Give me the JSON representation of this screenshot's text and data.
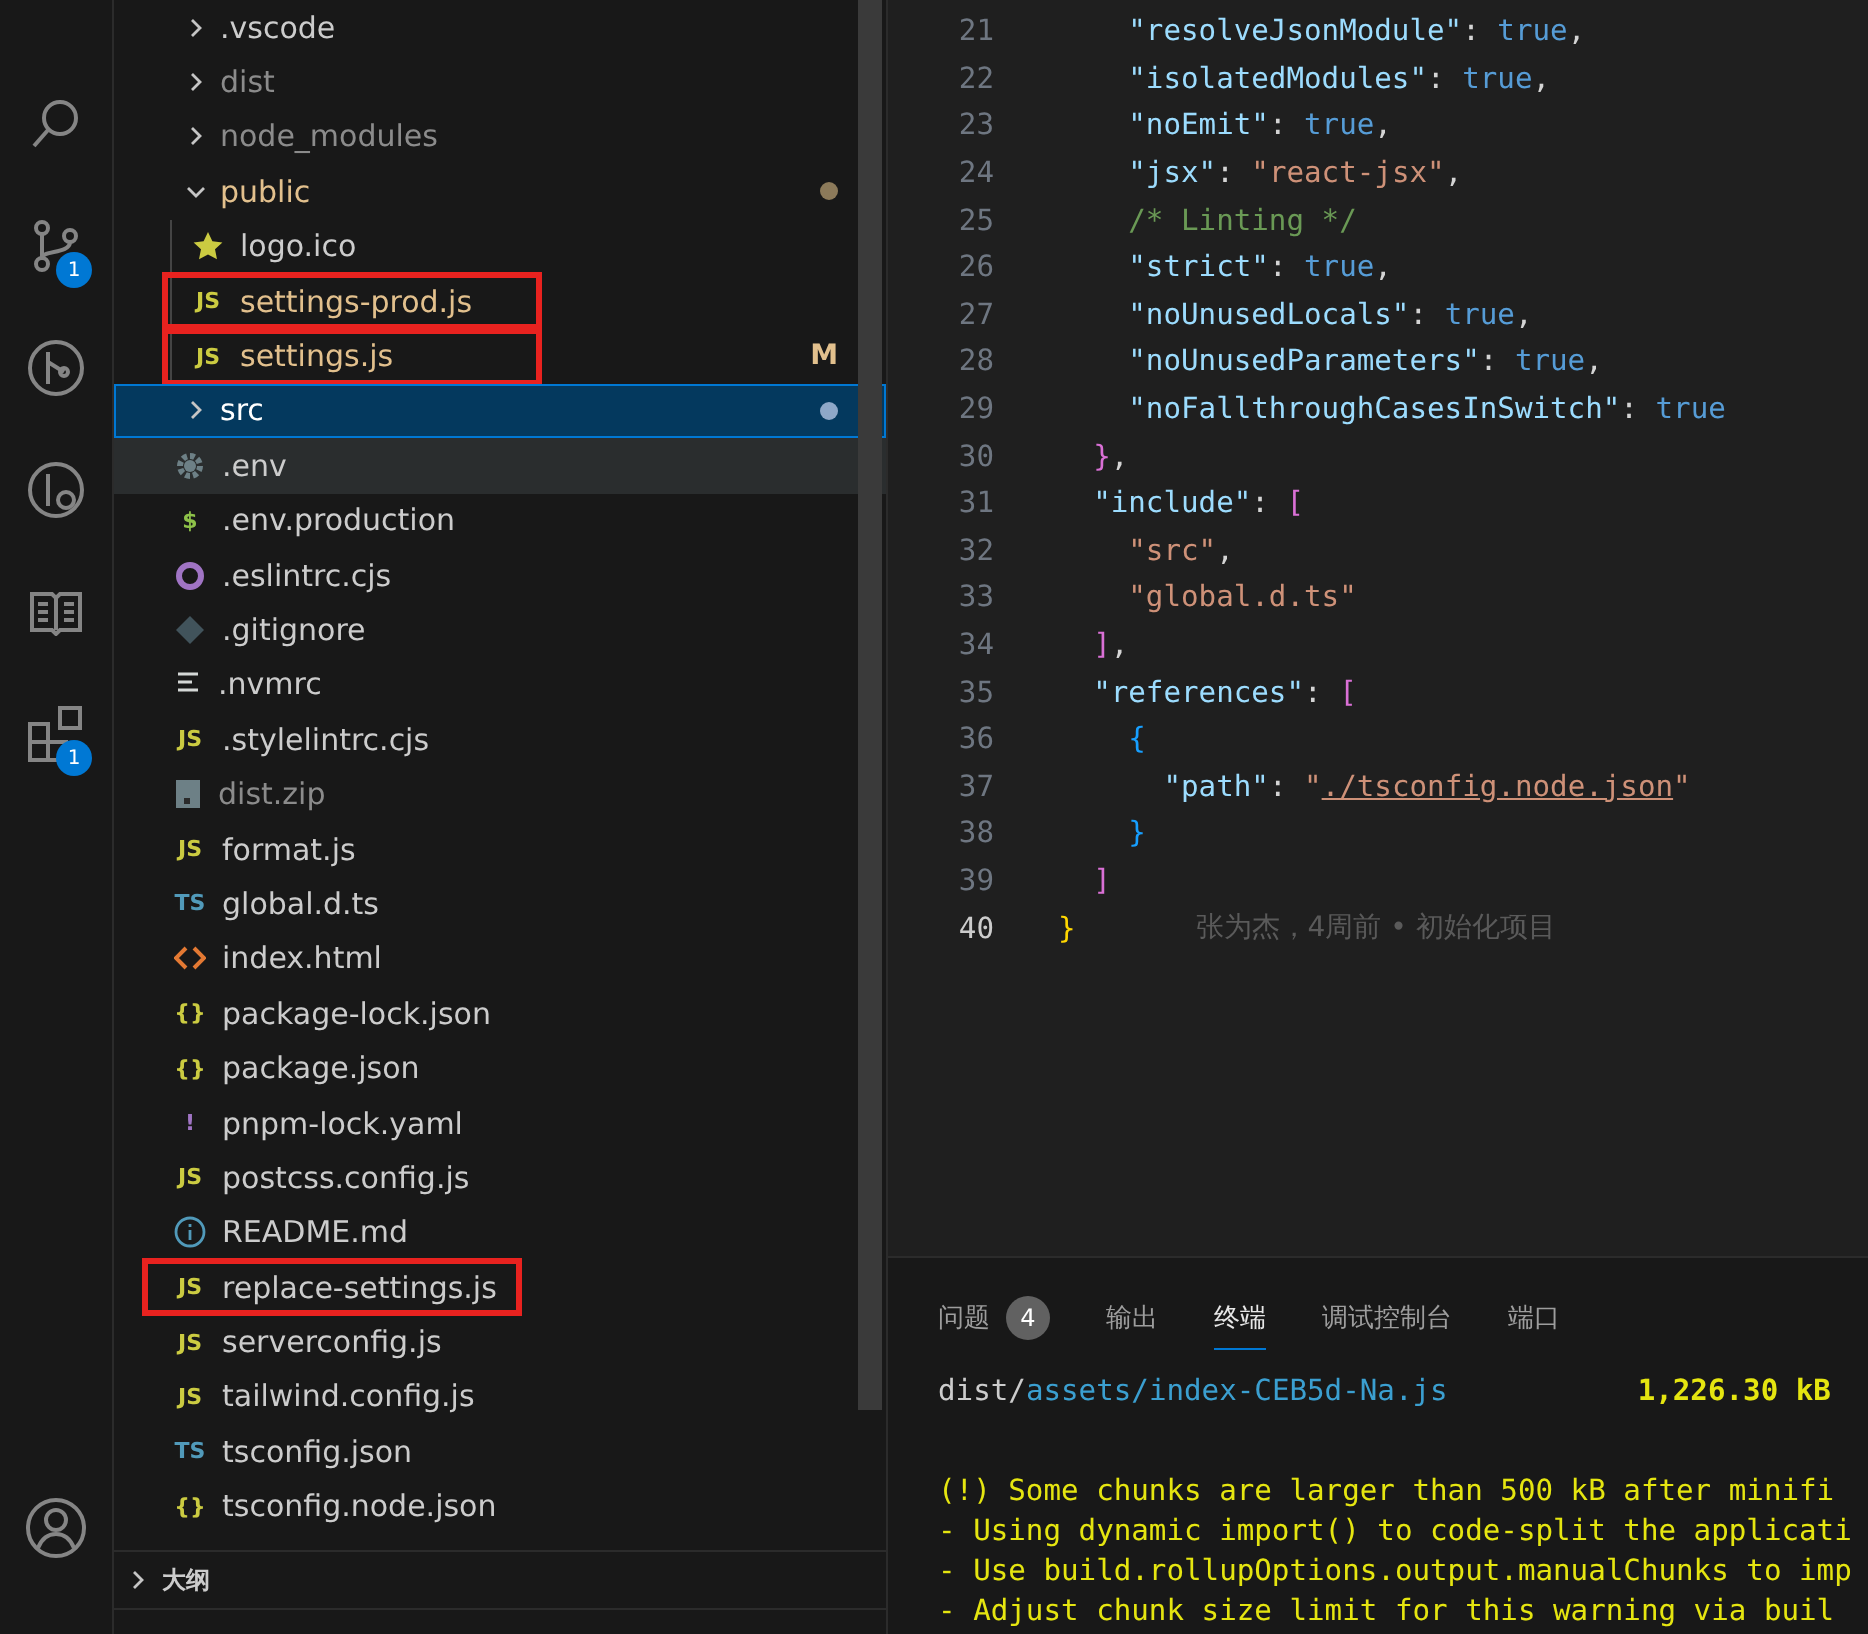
{
  "activity_bar": {
    "items": [
      {
        "kind": "search"
      },
      {
        "kind": "source-control",
        "badge": "1"
      },
      {
        "kind": "git-graph"
      },
      {
        "kind": "debug"
      },
      {
        "kind": "book"
      },
      {
        "kind": "extensions",
        "badge": "1"
      }
    ],
    "bottom": [
      {
        "kind": "account"
      }
    ]
  },
  "explorer": {
    "items": [
      {
        "name": ".vscode",
        "kind": "folder",
        "expanded": false,
        "dimmed": false,
        "modified": false,
        "selected": false,
        "hovered": false,
        "boxed": false,
        "pending": false
      },
      {
        "name": "dist",
        "kind": "folder",
        "expanded": false,
        "dimmed": true,
        "modified": false,
        "selected": false,
        "hovered": false,
        "boxed": false,
        "pending": false
      },
      {
        "name": "node_modules",
        "kind": "folder",
        "expanded": false,
        "dimmed": true,
        "modified": false,
        "selected": false,
        "hovered": false,
        "boxed": false,
        "pending": false
      },
      {
        "name": "public",
        "kind": "folder",
        "expanded": true,
        "dimmed": false,
        "modified": true,
        "selected": false,
        "hovered": false,
        "boxed": false,
        "pending": true,
        "children": [
          {
            "name": "logo.ico",
            "kind": "star",
            "dimmed": false,
            "modified": false,
            "selected": false,
            "hovered": false,
            "boxed": false
          },
          {
            "name": "settings-prod.js",
            "kind": "js",
            "glyph": "JS",
            "dimmed": false,
            "modified": true,
            "selected": false,
            "hovered": false,
            "boxed": true
          },
          {
            "name": "settings.js",
            "kind": "js",
            "glyph": "JS",
            "dimmed": false,
            "modified": true,
            "selected": false,
            "hovered": false,
            "boxed": true,
            "status": "M"
          }
        ]
      },
      {
        "name": "src",
        "kind": "folder",
        "expanded": false,
        "dimmed": false,
        "modified": false,
        "selected": true,
        "hovered": false,
        "boxed": false,
        "pending": true
      },
      {
        "name": ".env",
        "kind": "gear",
        "dimmed": false,
        "modified": false,
        "selected": false,
        "hovered": true,
        "boxed": false
      },
      {
        "name": ".env.production",
        "kind": "dollar",
        "glyph": "$",
        "dimmed": false,
        "modified": false,
        "selected": false,
        "hovered": false,
        "boxed": false
      },
      {
        "name": ".eslintrc.cjs",
        "kind": "ring",
        "dimmed": false,
        "modified": false,
        "selected": false,
        "hovered": false,
        "boxed": false
      },
      {
        "name": ".gitignore",
        "kind": "diamond",
        "dimmed": false,
        "modified": false,
        "selected": false,
        "hovered": false,
        "boxed": false
      },
      {
        "name": ".nvmrc",
        "kind": "lines",
        "dimmed": false,
        "modified": false,
        "selected": false,
        "hovered": false,
        "boxed": false
      },
      {
        "name": ".stylelintrc.cjs",
        "kind": "js",
        "glyph": "JS",
        "dimmed": false,
        "modified": false,
        "selected": false,
        "hovered": false,
        "boxed": false
      },
      {
        "name": "dist.zip",
        "kind": "archive",
        "dimmed": true,
        "modified": false,
        "selected": false,
        "hovered": false,
        "boxed": false
      },
      {
        "name": "format.js",
        "kind": "js",
        "glyph": "JS",
        "dimmed": false,
        "modified": false,
        "selected": false,
        "hovered": false,
        "boxed": false
      },
      {
        "name": "global.d.ts",
        "kind": "ts",
        "glyph": "TS",
        "dimmed": false,
        "modified": false,
        "selected": false,
        "hovered": false,
        "boxed": false
      },
      {
        "name": "index.html",
        "kind": "html",
        "dimmed": false,
        "modified": false,
        "selected": false,
        "hovered": false,
        "boxed": false
      },
      {
        "name": "package-lock.json",
        "kind": "json",
        "glyph": "{}",
        "dimmed": false,
        "modified": false,
        "selected": false,
        "hovered": false,
        "boxed": false
      },
      {
        "name": "package.json",
        "kind": "json",
        "glyph": "{}",
        "dimmed": false,
        "modified": false,
        "selected": false,
        "hovered": false,
        "boxed": false
      },
      {
        "name": "pnpm-lock.yaml",
        "kind": "yaml",
        "glyph": "!",
        "dimmed": false,
        "modified": false,
        "selected": false,
        "hovered": false,
        "boxed": false
      },
      {
        "name": "postcss.config.js",
        "kind": "js",
        "glyph": "JS",
        "dimmed": false,
        "modified": false,
        "selected": false,
        "hovered": false,
        "boxed": false
      },
      {
        "name": "README.md",
        "kind": "info",
        "dimmed": false,
        "modified": false,
        "selected": false,
        "hovered": false,
        "boxed": false
      },
      {
        "name": "replace-settings.js",
        "kind": "js",
        "glyph": "JS",
        "dimmed": false,
        "modified": false,
        "selected": false,
        "hovered": false,
        "boxed": true
      },
      {
        "name": "serverconfig.js",
        "kind": "js",
        "glyph": "JS",
        "dimmed": false,
        "modified": false,
        "selected": false,
        "hovered": false,
        "boxed": false
      },
      {
        "name": "tailwind.config.js",
        "kind": "js",
        "glyph": "JS",
        "dimmed": false,
        "modified": false,
        "selected": false,
        "hovered": false,
        "boxed": false
      },
      {
        "name": "tsconfig.json",
        "kind": "tsconfig",
        "glyph": "TS",
        "dimmed": false,
        "modified": false,
        "selected": false,
        "hovered": false,
        "boxed": false
      },
      {
        "name": "tsconfig.node.json",
        "kind": "json",
        "glyph": "{}",
        "dimmed": false,
        "modified": false,
        "selected": false,
        "hovered": false,
        "boxed": false
      }
    ]
  },
  "outline": {
    "title": "大纲",
    "expanded": false
  },
  "editor": {
    "lines": [
      {
        "num": "21",
        "current": false,
        "tokens": [
          {
            "kind": "key",
            "text": "    \"resolveJsonModule\""
          },
          {
            "kind": "punct",
            "text": ": "
          },
          {
            "kind": "keyword",
            "text": "true"
          },
          {
            "kind": "punct",
            "text": ","
          }
        ]
      },
      {
        "num": "22",
        "current": false,
        "tokens": [
          {
            "kind": "key",
            "text": "    \"isolatedModules\""
          },
          {
            "kind": "punct",
            "text": ": "
          },
          {
            "kind": "keyword",
            "text": "true"
          },
          {
            "kind": "punct",
            "text": ","
          }
        ]
      },
      {
        "num": "23",
        "current": false,
        "tokens": [
          {
            "kind": "key",
            "text": "    \"noEmit\""
          },
          {
            "kind": "punct",
            "text": ": "
          },
          {
            "kind": "keyword",
            "text": "true"
          },
          {
            "kind": "punct",
            "text": ","
          }
        ]
      },
      {
        "num": "24",
        "current": false,
        "tokens": [
          {
            "kind": "key",
            "text": "    \"jsx\""
          },
          {
            "kind": "punct",
            "text": ": "
          },
          {
            "kind": "string",
            "text": "\"react-jsx\""
          },
          {
            "kind": "punct",
            "text": ","
          }
        ]
      },
      {
        "num": "25",
        "current": false,
        "tokens": [
          {
            "kind": "comment",
            "text": "    /* Linting */"
          }
        ]
      },
      {
        "num": "26",
        "current": false,
        "tokens": [
          {
            "kind": "key",
            "text": "    \"strict\""
          },
          {
            "kind": "punct",
            "text": ": "
          },
          {
            "kind": "keyword",
            "text": "true"
          },
          {
            "kind": "punct",
            "text": ","
          }
        ]
      },
      {
        "num": "27",
        "current": false,
        "tokens": [
          {
            "kind": "key",
            "text": "    \"noUnusedLocals\""
          },
          {
            "kind": "punct",
            "text": ": "
          },
          {
            "kind": "keyword",
            "text": "true"
          },
          {
            "kind": "punct",
            "text": ","
          }
        ]
      },
      {
        "num": "28",
        "current": false,
        "tokens": [
          {
            "kind": "key",
            "text": "    \"noUnusedParameters\""
          },
          {
            "kind": "punct",
            "text": ": "
          },
          {
            "kind": "keyword",
            "text": "true"
          },
          {
            "kind": "punct",
            "text": ","
          }
        ]
      },
      {
        "num": "29",
        "current": false,
        "tokens": [
          {
            "kind": "key",
            "text": "    \"noFallthroughCasesInSwitch\""
          },
          {
            "kind": "punct",
            "text": ": "
          },
          {
            "kind": "keyword",
            "text": "true"
          }
        ]
      },
      {
        "num": "30",
        "current": false,
        "tokens": [
          {
            "kind": "bracket1",
            "text": "  }"
          },
          {
            "kind": "punct",
            "text": ","
          }
        ]
      },
      {
        "num": "31",
        "current": false,
        "tokens": [
          {
            "kind": "key",
            "text": "  \"include\""
          },
          {
            "kind": "punct",
            "text": ": "
          },
          {
            "kind": "bracket1",
            "text": "["
          }
        ]
      },
      {
        "num": "32",
        "current": false,
        "tokens": [
          {
            "kind": "string",
            "text": "    \"src\""
          },
          {
            "kind": "punct",
            "text": ","
          }
        ]
      },
      {
        "num": "33",
        "current": false,
        "tokens": [
          {
            "kind": "string",
            "text": "    \"global.d.ts\""
          }
        ]
      },
      {
        "num": "34",
        "current": false,
        "tokens": [
          {
            "kind": "bracket1",
            "text": "  ]"
          },
          {
            "kind": "punct",
            "text": ","
          }
        ]
      },
      {
        "num": "35",
        "current": false,
        "tokens": [
          {
            "kind": "key",
            "text": "  \"references\""
          },
          {
            "kind": "punct",
            "text": ": "
          },
          {
            "kind": "bracket1",
            "text": "["
          }
        ]
      },
      {
        "num": "36",
        "current": false,
        "tokens": [
          {
            "kind": "bracket2",
            "text": "    {"
          }
        ]
      },
      {
        "num": "37",
        "current": false,
        "tokens": [
          {
            "kind": "key",
            "text": "      \"path\""
          },
          {
            "kind": "punct",
            "text": ": "
          },
          {
            "kind": "string",
            "text": "\""
          },
          {
            "kind": "link",
            "text": "./tsconfig.node.json"
          },
          {
            "kind": "string",
            "text": "\""
          }
        ]
      },
      {
        "num": "38",
        "current": false,
        "tokens": [
          {
            "kind": "bracket2",
            "text": "    }"
          }
        ]
      },
      {
        "num": "39",
        "current": false,
        "tokens": [
          {
            "kind": "bracket1",
            "text": "  ]"
          }
        ]
      },
      {
        "num": "40",
        "current": true,
        "tokens": [
          {
            "kind": "bracket0",
            "text": "}"
          }
        ],
        "blame": "张为杰，4周前 • 初始化项目"
      }
    ]
  },
  "panel": {
    "tabs": [
      {
        "label": "问题",
        "count": "4",
        "selected": false
      },
      {
        "label": "输出",
        "selected": false
      },
      {
        "label": "终端",
        "selected": true
      },
      {
        "label": "调试控制台",
        "selected": false
      },
      {
        "label": "端口",
        "selected": false
      }
    ],
    "terminal": [
      {
        "segments": [
          {
            "kind": "plain",
            "text": "dist/"
          },
          {
            "kind": "path",
            "text": "assets/index-CEB5d-Na.js"
          },
          {
            "kind": "size",
            "text": "1,226.30 kB"
          }
        ]
      },
      {
        "segments": [
          {
            "kind": "warning",
            "text": "(!) Some chunks are larger than 500 kB after minifi"
          }
        ]
      },
      {
        "segments": [
          {
            "kind": "warning",
            "text": "- Using dynamic import() to code-split the applicati"
          }
        ]
      },
      {
        "segments": [
          {
            "kind": "warning",
            "text": "- Use build.rollupOptions.output.manualChunks to imp"
          }
        ]
      },
      {
        "segments": [
          {
            "kind": "warning",
            "text": "- Adjust chunk size limit for this warning via buil"
          }
        ]
      }
    ]
  }
}
